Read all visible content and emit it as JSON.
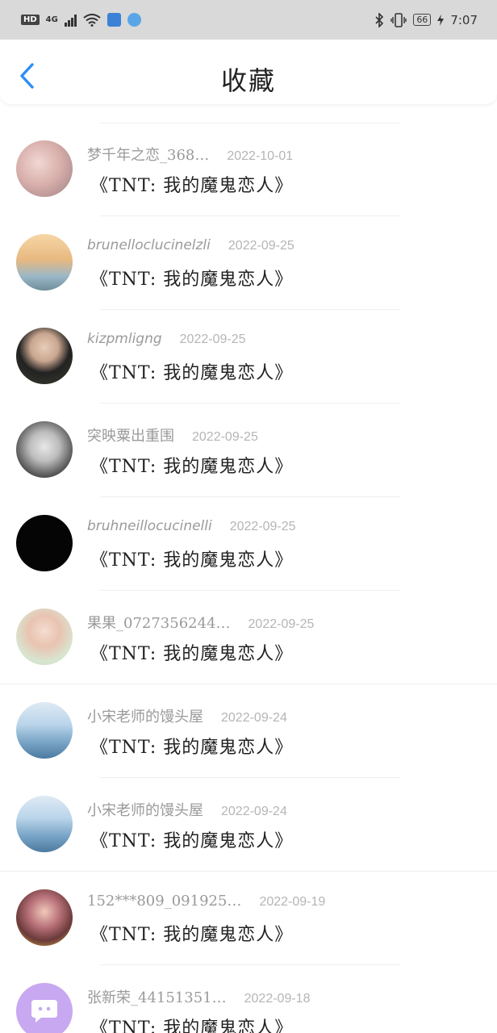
{
  "status_bar": {
    "hd": "HD",
    "network": "4G",
    "battery": "66",
    "time": "7:07"
  },
  "header": {
    "back_icon": "chevron-left-icon",
    "title": "收藏"
  },
  "colors": {
    "accent": "#2c8ef3",
    "status_bar_bg": "#d9d9d9",
    "username": "#9a9a9a",
    "date": "#b5b5b5"
  },
  "items": [
    {
      "user": "梦千年之恋_368…",
      "date": "2022-10-01",
      "title": "《TNT: 我的魔鬼恋人》"
    },
    {
      "user": "brunelloclucinelzli",
      "date": "2022-09-25",
      "title": "《TNT: 我的魔鬼恋人》"
    },
    {
      "user": "kizpmligng",
      "date": "2022-09-25",
      "title": "《TNT: 我的魔鬼恋人》"
    },
    {
      "user": "突映粟出重围",
      "date": "2022-09-25",
      "title": "《TNT: 我的魔鬼恋人》"
    },
    {
      "user": "bruhneillocucinelli",
      "date": "2022-09-25",
      "title": "《TNT: 我的魔鬼恋人》"
    },
    {
      "user": "果果_0727356244…",
      "date": "2022-09-25",
      "title": "《TNT: 我的魔鬼恋人》"
    },
    {
      "user": "小宋老师的馒头屋",
      "date": "2022-09-24",
      "title": "《TNT: 我的魔鬼恋人》"
    },
    {
      "user": "小宋老师的馒头屋",
      "date": "2022-09-24",
      "title": "《TNT: 我的魔鬼恋人》"
    },
    {
      "user": "152***809_091925…",
      "date": "2022-09-19",
      "title": "《TNT: 我的魔鬼恋人》"
    },
    {
      "user": "张新荣_44151351…",
      "date": "2022-09-18",
      "title": "《TNT: 我的魔鬼恋人》"
    }
  ]
}
